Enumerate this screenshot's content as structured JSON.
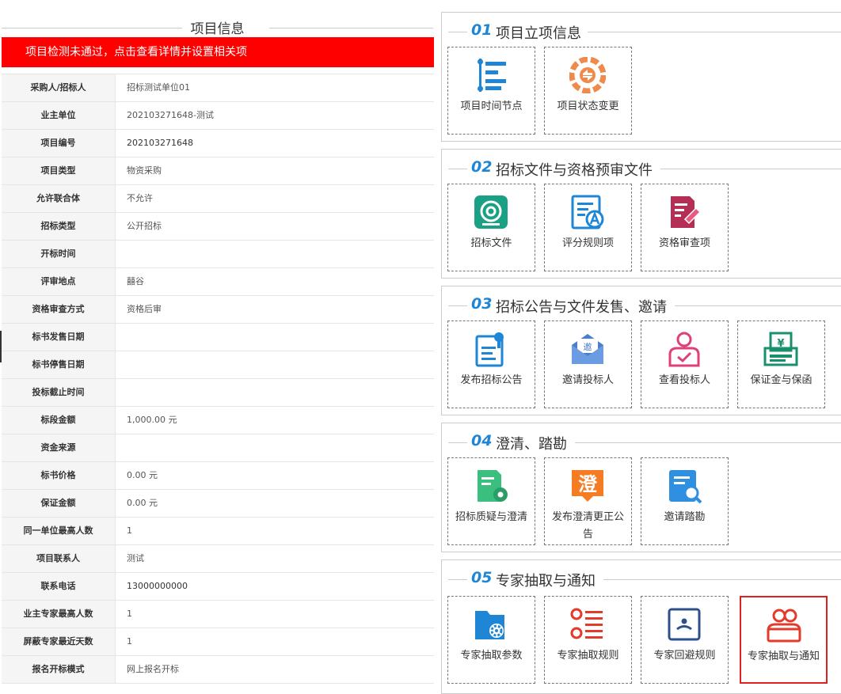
{
  "left_panel": {
    "title": "项目信息",
    "alert": "项目检测未通过，点击查看详情并设置相关项",
    "rows": [
      {
        "label": "采购人/招标人",
        "value": "招标测试单位01"
      },
      {
        "label": "业主单位",
        "value": "202103271648-测试"
      },
      {
        "label": "项目编号",
        "value": "202103271648"
      },
      {
        "label": "项目类型",
        "value": "物资采购"
      },
      {
        "label": "允许联合体",
        "value": "不允许"
      },
      {
        "label": "招标类型",
        "value": "公开招标"
      },
      {
        "label": "开标时间",
        "value": ""
      },
      {
        "label": "评审地点",
        "value": "囍谷"
      },
      {
        "label": "资格审查方式",
        "value": "资格后审"
      },
      {
        "label": "标书发售日期",
        "value": ""
      },
      {
        "label": "标书停售日期",
        "value": ""
      },
      {
        "label": "投标截止时间",
        "value": ""
      },
      {
        "label": "标段金额",
        "value": "1,000.00 元"
      },
      {
        "label": "资金来源",
        "value": ""
      },
      {
        "label": "标书价格",
        "value": "0.00 元"
      },
      {
        "label": "保证金额",
        "value": "0.00 元"
      },
      {
        "label": "同一单位最高人数",
        "value": "1"
      },
      {
        "label": "项目联系人",
        "value": "测试"
      },
      {
        "label": "联系电话",
        "value": "13000000000"
      },
      {
        "label": "业主专家最高人数",
        "value": "1"
      },
      {
        "label": "屏蔽专家最近天数",
        "value": "1"
      },
      {
        "label": "报名开标模式",
        "value": "网上报名开标"
      }
    ]
  },
  "sections": [
    {
      "num": "01",
      "title": "项目立项信息",
      "tiles": [
        {
          "label": "项目时间节点",
          "icon": "timeline-icon"
        },
        {
          "label": "项目状态变更",
          "icon": "status-change-icon"
        }
      ]
    },
    {
      "num": "02",
      "title": "招标文件与资格预审文件",
      "tiles": [
        {
          "label": "招标文件",
          "icon": "tender-document-icon"
        },
        {
          "label": "评分规则项",
          "icon": "scoring-rules-icon"
        },
        {
          "label": "资格审查项",
          "icon": "qualification-review-icon"
        }
      ]
    },
    {
      "num": "03",
      "title": "招标公告与文件发售、邀请",
      "tiles": [
        {
          "label": "发布招标公告",
          "icon": "publish-notice-icon"
        },
        {
          "label": "邀请投标人",
          "icon": "invite-bidder-icon"
        },
        {
          "label": "查看投标人",
          "icon": "view-bidder-icon"
        },
        {
          "label": "保证金与保函",
          "icon": "deposit-guarantee-icon"
        }
      ]
    },
    {
      "num": "04",
      "title": "澄清、踏勘",
      "tiles": [
        {
          "label": "招标质疑与澄清",
          "icon": "query-clarify-icon"
        },
        {
          "label": "发布澄清更正公告",
          "icon": "clarify-notice-icon"
        },
        {
          "label": "邀请踏勘",
          "icon": "site-visit-icon"
        }
      ]
    },
    {
      "num": "05",
      "title": "专家抽取与通知",
      "tiles": [
        {
          "label": "专家抽取参数",
          "icon": "expert-params-icon"
        },
        {
          "label": "专家抽取规则",
          "icon": "expert-rules-icon"
        },
        {
          "label": "专家回避规则",
          "icon": "expert-avoid-icon"
        },
        {
          "label": "专家抽取与通知",
          "icon": "expert-notify-icon"
        }
      ]
    }
  ],
  "colors": {
    "alert": "#ff0000",
    "accent": "#1f86d6",
    "selected_border": "#e02020"
  }
}
